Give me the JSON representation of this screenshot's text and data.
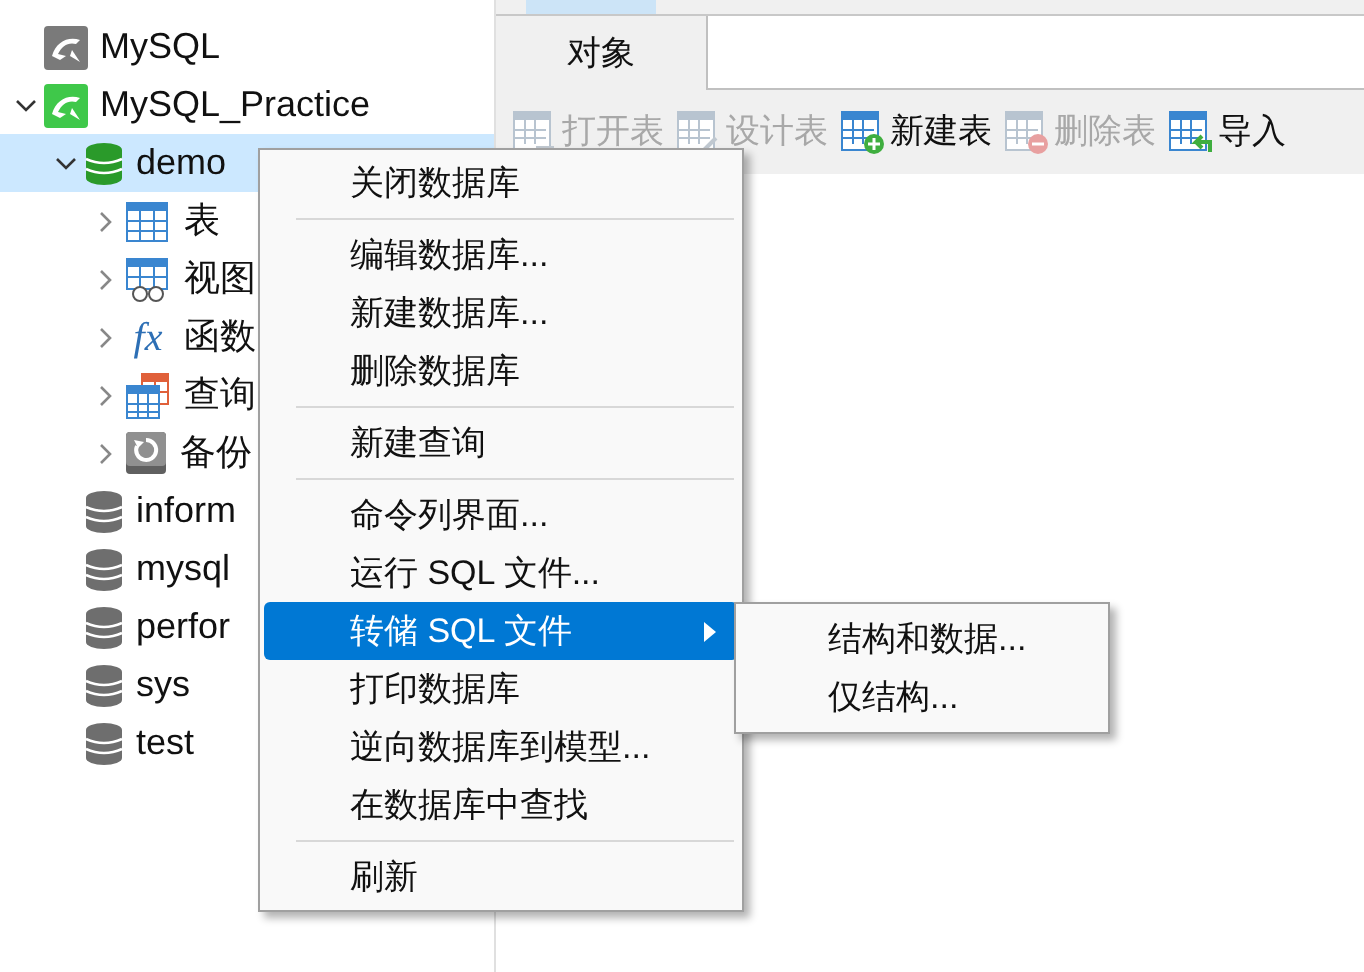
{
  "tree": [
    {
      "label": "MySQL",
      "kind": "connection",
      "selected": false
    },
    {
      "label": "MySQL_Practice",
      "kind": "connection-open",
      "expanded": true,
      "selected": false,
      "children": [
        {
          "label": "demo",
          "kind": "database-open",
          "expanded": true,
          "selected": true,
          "children": [
            {
              "label": "表",
              "kind": "table",
              "expanded": false,
              "selected": false
            },
            {
              "label": "视图",
              "kind": "view",
              "expanded": false,
              "selected": false
            },
            {
              "label": "函数",
              "kind": "function",
              "icon_text": "fx",
              "expanded": false,
              "selected": false
            },
            {
              "label": "查询",
              "kind": "query",
              "expanded": false,
              "selected": false
            },
            {
              "label": "备份",
              "kind": "backup",
              "expanded": false,
              "selected": false
            }
          ]
        },
        {
          "label": "inform",
          "kind": "database",
          "selected": false
        },
        {
          "label": "mysql",
          "kind": "database",
          "selected": false
        },
        {
          "label": "perfor",
          "kind": "database",
          "selected": false
        },
        {
          "label": "sys",
          "kind": "database",
          "selected": false
        },
        {
          "label": "test",
          "kind": "database",
          "selected": false
        }
      ]
    }
  ],
  "tabs": [
    {
      "label": "对象",
      "selected": true
    }
  ],
  "toolbar": [
    {
      "label": "打开表",
      "kind": "open",
      "disabled": true
    },
    {
      "label": "设计表",
      "kind": "design",
      "disabled": true
    },
    {
      "label": "新建表",
      "kind": "new",
      "disabled": false
    },
    {
      "label": "删除表",
      "kind": "delete",
      "disabled": true
    },
    {
      "label": "导入",
      "kind": "import",
      "disabled": false
    }
  ],
  "context_menu": [
    {
      "kind": "item",
      "label": "关闭数据库",
      "selected": false
    },
    {
      "kind": "separator"
    },
    {
      "kind": "item",
      "label": "编辑数据库...",
      "selected": false
    },
    {
      "kind": "item",
      "label": "新建数据库...",
      "selected": false
    },
    {
      "kind": "item",
      "label": "删除数据库",
      "selected": false
    },
    {
      "kind": "separator"
    },
    {
      "kind": "item",
      "label": "新建查询",
      "selected": false
    },
    {
      "kind": "separator"
    },
    {
      "kind": "item",
      "label": "命令列界面...",
      "selected": false
    },
    {
      "kind": "item",
      "label": "运行 SQL 文件...",
      "selected": false
    },
    {
      "kind": "item",
      "label": "转储 SQL 文件",
      "selected": true,
      "submenu": true
    },
    {
      "kind": "item",
      "label": "打印数据库",
      "selected": false
    },
    {
      "kind": "item",
      "label": "逆向数据库到模型...",
      "selected": false
    },
    {
      "kind": "item",
      "label": "在数据库中查找",
      "selected": false
    },
    {
      "kind": "separator"
    },
    {
      "kind": "item",
      "label": "刷新",
      "selected": false
    }
  ],
  "submenu": [
    {
      "label": "结构和数据...",
      "selected": false
    },
    {
      "label": "仅结构...",
      "selected": false
    }
  ]
}
